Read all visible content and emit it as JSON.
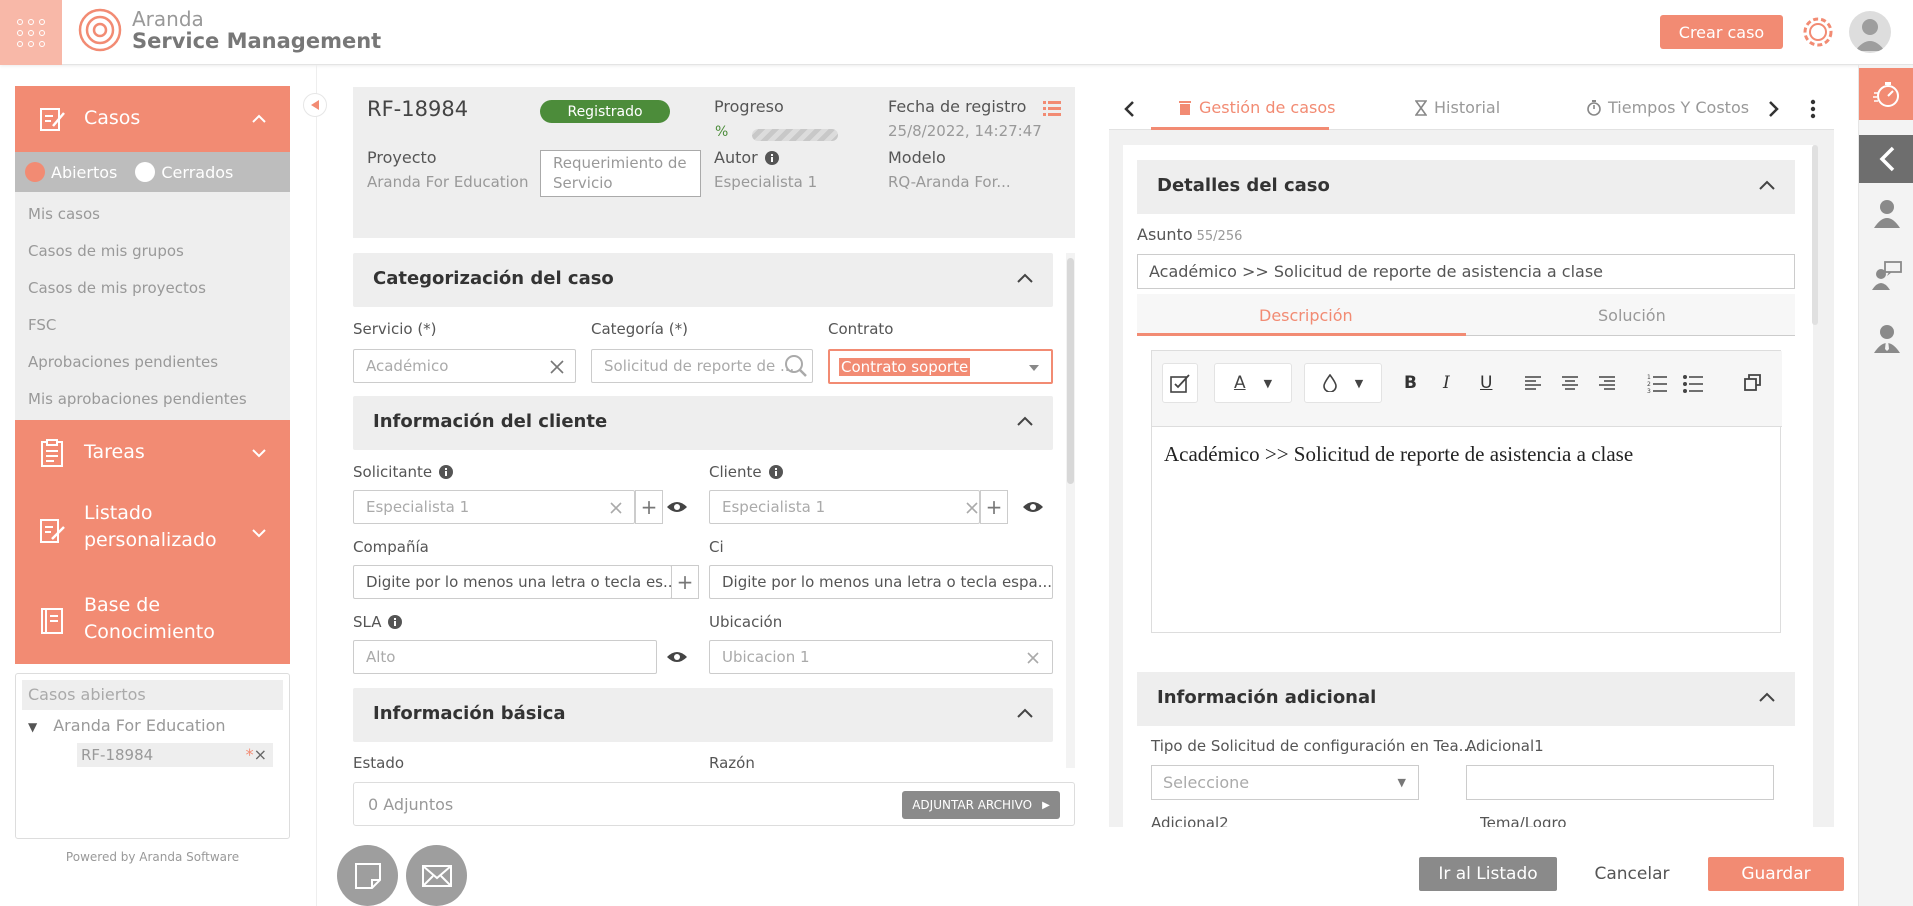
{
  "app": {
    "name_l1": "Aranda",
    "name_l2": "Service Management",
    "create_case": "Crear caso"
  },
  "sidebar": {
    "casos": "Casos",
    "open_label": "Abiertos",
    "closed_label": "Cerrados",
    "items": [
      "Mis casos",
      "Casos de mis grupos",
      "Casos de mis proyectos",
      "FSC",
      "Aprobaciones pendientes",
      "Mis aprobaciones pendientes"
    ],
    "tareas": "Tareas",
    "listado_l1": "Listado",
    "listado_l2": "personalizado",
    "base_l1": "Base de",
    "base_l2": "Conocimiento",
    "open_cases_title": "Casos abiertos",
    "tree_project": "Aranda For Education",
    "tree_case": "RF-18984",
    "powered": "Powered by Aranda Software"
  },
  "case": {
    "id": "RF-18984",
    "status": "Registrado",
    "progress_label": "Progreso",
    "progress_pct": "%",
    "date_label": "Fecha de registro",
    "date_value": "25/8/2022, 14:27:47",
    "project_label": "Proyecto",
    "project_value": "Aranda For Education",
    "type_value": "Requerimiento de Servicio",
    "author_label": "Autor",
    "author_value": "Especialista 1",
    "model_label": "Modelo",
    "model_value": "RQ-Aranda For..."
  },
  "form": {
    "cat_title": "Categorización del caso",
    "servicio_label": "Servicio (*)",
    "servicio_value": "Académico",
    "categoria_label": "Categoría (*)",
    "categoria_value": "Solicitud de reporte de ...",
    "contrato_label": "Contrato",
    "contrato_value": "Contrato soporte",
    "client_title": "Información del cliente",
    "solicitante_label": "Solicitante",
    "solicitante_value": "Especialista 1",
    "cliente_label": "Cliente",
    "cliente_value": "Especialista 1",
    "compania_label": "Compañía",
    "compania_placeholder": "Digite por lo menos una letra o tecla es...",
    "ci_label": "Ci",
    "ci_placeholder": "Digite por lo menos una letra o tecla espa...",
    "sla_label": "SLA",
    "sla_value": "Alto",
    "ubicacion_label": "Ubicación",
    "ubicacion_value": "Ubicacion 1",
    "basic_title": "Información básica",
    "estado_label": "Estado",
    "razon_label": "Razón"
  },
  "attach": {
    "count": "0 Adjuntos",
    "button": "ADJUNTAR ARCHIVO"
  },
  "right": {
    "tabs": [
      "Gestión de casos",
      "Historial",
      "Tiempos Y Costos"
    ],
    "details_title": "Detalles del caso",
    "asunto_label": "Asunto",
    "asunto_count": "55/256",
    "asunto_value": "Académico >> Solicitud de reporte de asistencia a clase",
    "desc_tab": "Descripción",
    "sol_tab": "Solución",
    "editor_text": "Académico >> Solicitud de reporte de asistencia a clase",
    "extra_title": "Información adicional",
    "tipo_label": "Tipo de Solicitud de configuración en Tea...",
    "adicional1_label": "Adicional1",
    "select_placeholder": "Seleccione",
    "adicional2_label": "Adicional2",
    "tema_label": "Tema/Logro"
  },
  "footer": {
    "listado": "Ir al Listado",
    "cancelar": "Cancelar",
    "guardar": "Guardar"
  },
  "colors": {
    "accent": "#f28b73",
    "status_green": "#4c8c3a"
  }
}
